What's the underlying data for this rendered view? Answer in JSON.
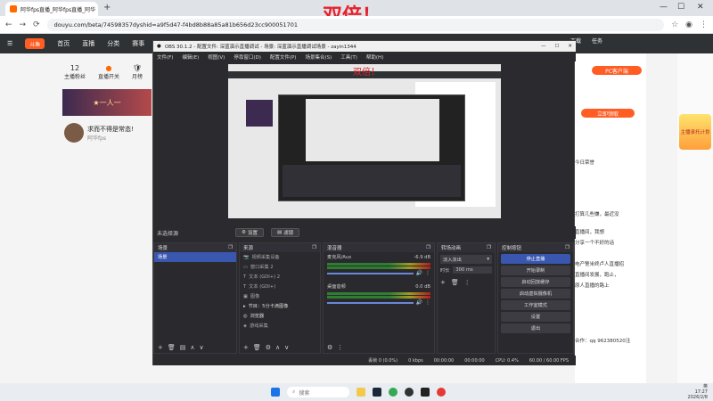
{
  "browser": {
    "tab_title": "阿华fps直播_阿华fps直播_阿华",
    "url": "douyu.com/beta/74598357dyshid=a9f5d47-f4bd8b88a85a81b656d23cc900051701",
    "overlay_title": "双倍！",
    "window_controls": [
      "—",
      "☐",
      "✕"
    ]
  },
  "douyu": {
    "nav": [
      "首页",
      "直播",
      "分类",
      "赛事"
    ],
    "stats": [
      {
        "value": "12",
        "label": "主播粉丝"
      },
      {
        "value": "",
        "label": "直播开关"
      },
      {
        "value": "",
        "label": "月榜"
      }
    ],
    "banner_text": "★一人一",
    "streamer_name": "求而不得是常态!",
    "streamer_tag": "阿华fps",
    "right_top_button": "PC客户端",
    "right_tags": [
      "主播承托计划",
      "立即领取"
    ],
    "chat_lines": [
      "今日荣誉",
      "打算几些嫌，最近没",
      "直播间，我想",
      "分享一个不好的话",
      "电产警米终卢人直播招",
      "直播间发展，跑止，",
      "原人直播的路上",
      "合作：qq 962380520注"
    ],
    "right_side_icons": [
      "下载",
      "任务"
    ]
  },
  "obs": {
    "title": "OBS 30.1.2 - 配置文件: 深蓝演示直播调试 - 场景: 深蓝演示直播调试场景 - zayin1344",
    "menu": [
      "文件(F)",
      "编辑(E)",
      "视图(V)",
      "停靠窗口(D)",
      "配置文件(P)",
      "场景集合(S)",
      "工具(T)",
      "帮助(H)"
    ],
    "preview_overlay": "双倍！",
    "source_row": {
      "label": "未选择源",
      "settings": "设置",
      "filters": "滤镜"
    },
    "docks": {
      "scenes": {
        "title": "场景",
        "items": [
          "场景"
        ]
      },
      "sources": {
        "title": "来源",
        "items": [
          "视频采集设备",
          "窗口采集 2",
          "文本 (GDI+) 2",
          "文本 (GDI+)",
          "图像",
          "节目：5分卡滴图像",
          "浏览器",
          "游戏采集"
        ]
      },
      "mixer": {
        "title": "混音器",
        "channels": [
          {
            "name": "麦克风/Aux",
            "db": "-6.9 dB"
          },
          {
            "name": "桌面音频",
            "db": "0.0 dB"
          }
        ]
      },
      "transitions": {
        "title": "转场动画",
        "type": "淡入淡出",
        "duration_label": "时长",
        "duration": "300 ms"
      },
      "controls": {
        "title": "控制按钮",
        "buttons": [
          "停止直播",
          "开始录制",
          "启动回放缓存",
          "启动虚拟摄像机",
          "工作室模式",
          "设置",
          "退出"
        ]
      }
    },
    "status": {
      "dropped": "丢帧 0 (0.0%)",
      "bitrate": "0 kbps",
      "live_time": "00:00:00",
      "rec_time": "00:00:00",
      "cpu": "CPU: 0.4%",
      "fps": "60.00 / 60.00 FPS"
    }
  },
  "taskbar": {
    "search_placeholder": "搜索",
    "lang": "英",
    "time": "17:27",
    "date": "2026/2/8"
  }
}
